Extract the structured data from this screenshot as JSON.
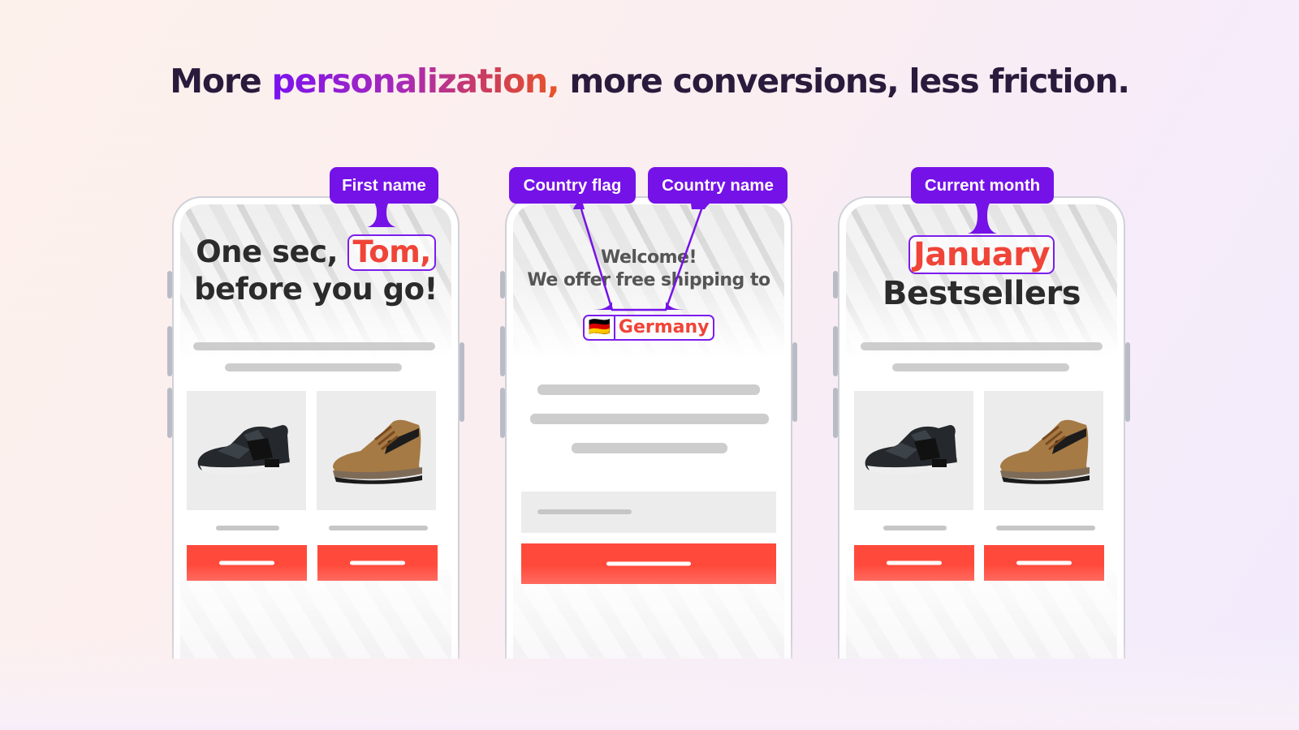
{
  "headline": {
    "prefix": "More ",
    "accent": "personalization,",
    "suffix": " more conversions, less friction.",
    "accent_gradient": [
      "#7a12f0",
      "#e8552a"
    ],
    "text_color": "#2a1a3c"
  },
  "colors": {
    "tag_background": "#7512e8",
    "token_border": "#7c1ded",
    "highlight_red": "#f04438",
    "cta_red": "#ff4a3b",
    "skeleton_gray": "#cdcdcd"
  },
  "phones": [
    {
      "tags": [
        {
          "label": "First name"
        }
      ],
      "title_line1_prefix": "One sec, ",
      "title_token": "Tom,",
      "title_line2": "before you go!",
      "products": [
        {
          "icon": "sneaker-icon",
          "alt": "Black sneaker"
        },
        {
          "icon": "boot-icon",
          "alt": "Brown hiking boot"
        }
      ]
    },
    {
      "tags": [
        {
          "label": "Country flag"
        },
        {
          "label": "Country name"
        }
      ],
      "welcome": "Welcome!",
      "subtitle": "We offer free shipping to",
      "flag_token": "🇩🇪",
      "country_token": "Germany"
    },
    {
      "tags": [
        {
          "label": "Current month"
        }
      ],
      "title_token": "January",
      "title_line2": "Bestsellers",
      "products": [
        {
          "icon": "sneaker-icon",
          "alt": "Black sneaker"
        },
        {
          "icon": "boot-icon",
          "alt": "Brown hiking boot"
        }
      ]
    }
  ]
}
